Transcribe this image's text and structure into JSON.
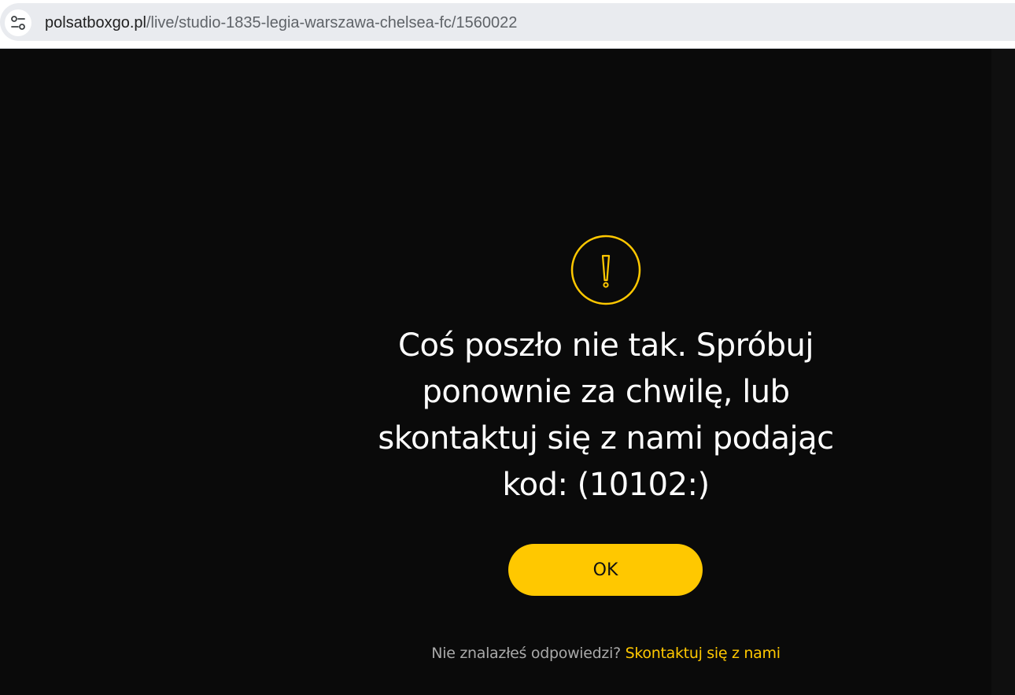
{
  "browser": {
    "url_host": "polsatboxgo.pl",
    "url_path": "/live/studio-1835-legia-warszawa-chelsea-fc/1560022",
    "site_info_icon": "tune-icon"
  },
  "error_dialog": {
    "icon": "warning-circle-icon",
    "message": "Coś poszło nie tak. Spróbuj ponownie za chwilę, lub skontaktuj się z nami podając kod: (10102:)",
    "ok_label": "OK",
    "help_question": "Nie znalazłeś odpowiedzi?",
    "help_link": "Skontaktuj się z nami"
  },
  "colors": {
    "background": "#0a0a0a",
    "accent": "#ffc800",
    "text": "#ffffff",
    "muted_text": "#a9a9a9"
  }
}
